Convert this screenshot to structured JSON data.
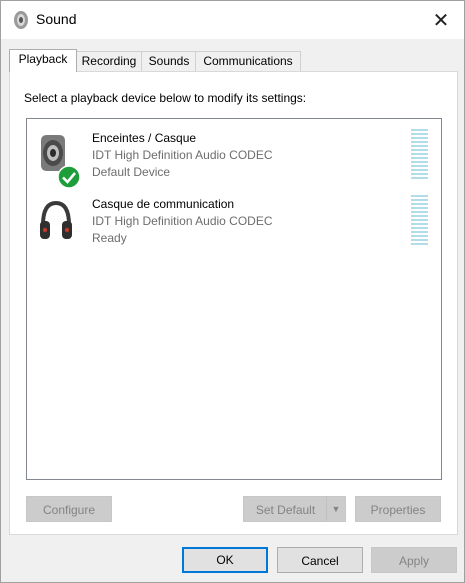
{
  "window": {
    "title": "Sound",
    "close_glyph": "✕"
  },
  "tabs": [
    {
      "label": "Playback",
      "active": true
    },
    {
      "label": "Recording",
      "active": false
    },
    {
      "label": "Sounds",
      "active": false
    },
    {
      "label": "Communications",
      "active": false
    }
  ],
  "panel": {
    "prompt": "Select a playback device below to modify its settings:",
    "devices": [
      {
        "name": "Enceintes / Casque",
        "driver": "IDT High Definition Audio CODEC",
        "status": "Default Device",
        "icon": "speaker-icon",
        "default": true
      },
      {
        "name": "Casque de communication",
        "driver": "IDT High Definition Audio CODEC",
        "status": "Ready",
        "icon": "headphones-icon",
        "default": false
      }
    ],
    "buttons": {
      "configure": "Configure",
      "set_default": "Set Default",
      "properties": "Properties"
    }
  },
  "footer": {
    "ok": "OK",
    "cancel": "Cancel",
    "apply": "Apply"
  },
  "colors": {
    "accent": "#0078d7",
    "meter": "#b2dde8",
    "default_badge": "#1e9e3b"
  }
}
